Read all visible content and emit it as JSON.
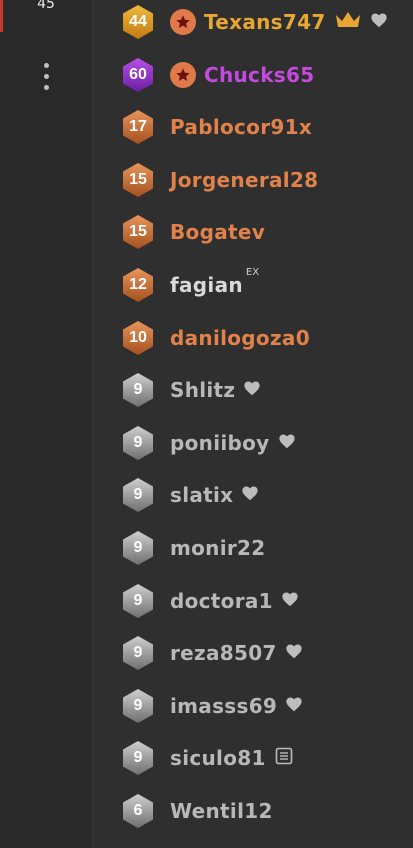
{
  "rail": {
    "count": "45"
  },
  "colors": {
    "orange": "#e0824a",
    "gold": "#e8a632",
    "purple": "#c44ae0",
    "gray": "#b8b8b8",
    "heart": "#bdbdbd"
  },
  "players": [
    {
      "level": "44",
      "name": "Texans747",
      "tier": "gold",
      "star": true,
      "crown": true,
      "heart": true
    },
    {
      "level": "60",
      "name": "Chucks65",
      "tier": "purple",
      "star": true
    },
    {
      "level": "17",
      "name": "Pablocor91x",
      "tier": "bronze"
    },
    {
      "level": "15",
      "name": "Jorgeneral28",
      "tier": "bronze"
    },
    {
      "level": "15",
      "name": "Bogatev",
      "tier": "bronze"
    },
    {
      "level": "12",
      "name": "fagian",
      "tier": "bronze",
      "name_style": "light",
      "superscript": "EX"
    },
    {
      "level": "10",
      "name": "danilogoza0",
      "tier": "bronze"
    },
    {
      "level": "9",
      "name": "Shlitz",
      "tier": "silver",
      "heart": true
    },
    {
      "level": "9",
      "name": "poniiboy",
      "tier": "silver",
      "heart": true
    },
    {
      "level": "9",
      "name": "slatix",
      "tier": "silver",
      "heart": true
    },
    {
      "level": "9",
      "name": "monir22",
      "tier": "silver"
    },
    {
      "level": "9",
      "name": "doctora1",
      "tier": "silver",
      "heart": true
    },
    {
      "level": "9",
      "name": "reza8507",
      "tier": "silver",
      "heart": true
    },
    {
      "level": "9",
      "name": "imasss69",
      "tier": "silver",
      "heart": true
    },
    {
      "level": "9",
      "name": "siculo81",
      "tier": "silver",
      "note": true
    },
    {
      "level": "6",
      "name": "Wentil12",
      "tier": "silver"
    }
  ]
}
